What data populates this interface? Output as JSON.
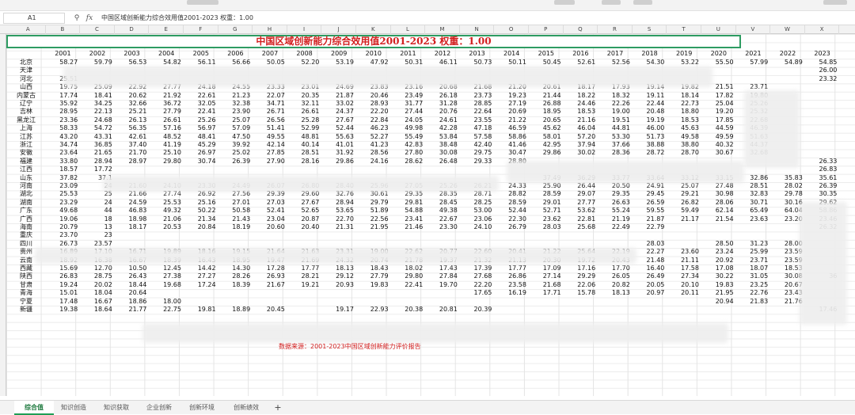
{
  "formula_bar": {
    "cell_ref": "A1",
    "formula": "中国区域创新能力综合效用值2001-2023   权重：1.00",
    "zoom_icon": "zoom-icon",
    "fx_label": "fx"
  },
  "columns": [
    "A",
    "B",
    "C",
    "D",
    "E",
    "F",
    "G",
    "H",
    "I",
    "J",
    "K",
    "L",
    "M",
    "N",
    "O",
    "P",
    "Q",
    "R",
    "S",
    "T",
    "U",
    "V",
    "W",
    "X"
  ],
  "title": "中国区域创新能力综合效用值2001-2023    权重：1.00",
  "years": [
    "2001",
    "2002",
    "2003",
    "2004",
    "2005",
    "2006",
    "2007",
    "2008",
    "2009",
    "2010",
    "2011",
    "2012",
    "2013",
    "2014",
    "2015",
    "2016",
    "2017",
    "2018",
    "2019",
    "2020",
    "2021",
    "2022",
    "2023"
  ],
  "regions": [
    "北京",
    "天津",
    "河北",
    "山西",
    "内蒙古",
    "辽宁",
    "吉林",
    "黑龙江",
    "上海",
    "江苏",
    "浙江",
    "安徽",
    "福建",
    "江西",
    "山东",
    "河南",
    "湖北",
    "湖南",
    "广东",
    "广西",
    "海南",
    "重庆",
    "四川",
    "贵州",
    "云南",
    "西藏",
    "陕西",
    "甘肃",
    "青海",
    "宁夏",
    "新疆"
  ],
  "rows": [
    [
      "58.27",
      "59.79",
      "56.53",
      "54.82",
      "56.11",
      "56.66",
      "50.05",
      "52.20",
      "53.19",
      "47.92",
      "50.31",
      "46.11",
      "50.73",
      "50.11",
      "50.45",
      "52.61",
      "52.56",
      "54.30",
      "53.22",
      "55.50",
      "57.99",
      "54.89",
      "54.85"
    ],
    [
      "",
      "",
      "",
      "",
      "",
      "",
      "",
      "",
      "",
      "",
      "",
      "",
      "",
      "",
      "",
      "",
      "",
      "",
      "",
      "",
      "",
      "",
      "26.00"
    ],
    [
      "25.51",
      "",
      "",
      "",
      "",
      "",
      "",
      "",
      "",
      "",
      "",
      "",
      "",
      "",
      "",
      "",
      "",
      "",
      "",
      "",
      "",
      "",
      "23.32"
    ],
    [
      "19.75",
      "25.09",
      "22.92",
      "27.77",
      "24.18",
      "24.55",
      "23.33",
      "23.01",
      "24.69",
      "23.83",
      "23.16",
      "20.68",
      "21.68",
      "21.20",
      "20.61",
      "18.17",
      "17.93",
      "19.14",
      "19.82",
      "21.51",
      "23.71",
      "",
      ""
    ],
    [
      "17.74",
      "18.41",
      "20.62",
      "21.92",
      "22.61",
      "21.23",
      "22.07",
      "20.35",
      "21.87",
      "20.46",
      "23.49",
      "26.18",
      "23.73",
      "19.23",
      "21.44",
      "18.22",
      "18.32",
      "19.11",
      "18.14",
      "17.82",
      "19.80",
      "",
      ""
    ],
    [
      "35.92",
      "34.25",
      "32.66",
      "36.72",
      "32.05",
      "32.38",
      "34.71",
      "32.11",
      "33.02",
      "28.93",
      "31.77",
      "31.28",
      "28.85",
      "27.19",
      "26.88",
      "24.46",
      "22.26",
      "22.44",
      "22.73",
      "25.04",
      "25.26",
      "",
      ""
    ],
    [
      "28.95",
      "22.13",
      "25.21",
      "27.79",
      "22.41",
      "23.90",
      "26.71",
      "26.61",
      "24.37",
      "22.20",
      "27.44",
      "20.76",
      "22.64",
      "20.69",
      "18.95",
      "18.53",
      "19.00",
      "20.48",
      "18.80",
      "19.20",
      "25.32",
      "",
      ""
    ],
    [
      "23.36",
      "24.68",
      "26.13",
      "26.61",
      "25.26",
      "25.07",
      "26.56",
      "25.28",
      "27.67",
      "22.84",
      "24.05",
      "24.61",
      "23.55",
      "21.22",
      "20.65",
      "21.16",
      "19.51",
      "19.19",
      "18.53",
      "17.85",
      "22.68",
      "",
      ""
    ],
    [
      "58.33",
      "54.72",
      "56.35",
      "57.16",
      "56.97",
      "57.09",
      "51.41",
      "52.99",
      "52.44",
      "46.23",
      "49.98",
      "42.28",
      "47.18",
      "46.59",
      "45.62",
      "46.04",
      "44.81",
      "46.00",
      "45.63",
      "44.59",
      "46.39",
      "",
      ""
    ],
    [
      "43.20",
      "43.31",
      "42.61",
      "48.52",
      "48.41",
      "47.50",
      "49.55",
      "48.81",
      "55.63",
      "52.27",
      "55.49",
      "53.84",
      "57.58",
      "58.86",
      "58.01",
      "57.20",
      "53.30",
      "51.73",
      "49.58",
      "49.59",
      "51.63",
      "",
      ""
    ],
    [
      "34.74",
      "36.85",
      "37.40",
      "41.19",
      "45.29",
      "39.92",
      "42.14",
      "40.14",
      "41.01",
      "41.23",
      "42.83",
      "38.48",
      "42.40",
      "41.46",
      "42.95",
      "37.94",
      "37.66",
      "38.88",
      "38.80",
      "40.32",
      "44.37",
      "",
      ""
    ],
    [
      "23.64",
      "21.65",
      "21.70",
      "25.10",
      "26.97",
      "25.02",
      "27.85",
      "28.51",
      "31.92",
      "28.56",
      "27.80",
      "30.08",
      "29.75",
      "30.47",
      "29.86",
      "30.02",
      "28.36",
      "28.72",
      "28.70",
      "30.67",
      "32.68",
      "",
      ""
    ],
    [
      "33.80",
      "28.94",
      "28.97",
      "29.80",
      "30.74",
      "26.39",
      "27.90",
      "28.16",
      "29.86",
      "24.16",
      "28.62",
      "26.48",
      "29.33",
      "28.80",
      "",
      "",
      "",
      "",
      "",
      "",
      "",
      "",
      "26.33"
    ],
    [
      "18.57",
      "17.72",
      "",
      "",
      "",
      "",
      "",
      "",
      "",
      "",
      "",
      "",
      "",
      "",
      "",
      "",
      "",
      "",
      "",
      "",
      "",
      "",
      "26.83"
    ],
    [
      "37.82",
      "37.1",
      "",
      "",
      "",
      "",
      "",
      "",
      "",
      "",
      "",
      "",
      "",
      "",
      "37.49",
      "36.29",
      "33.77",
      "33.64",
      "33.12",
      "33.15",
      "32.86",
      "35.83",
      "35.61"
    ],
    [
      "23.09",
      "24",
      "21.60",
      "24.10",
      "23.30",
      "24.49",
      "26.07",
      "26.80",
      "28.40",
      "25.96",
      "27.05",
      "25.26",
      "26.21",
      "24.33",
      "25.90",
      "26.44",
      "20.50",
      "24.91",
      "25.07",
      "27.48",
      "28.51",
      "28.02",
      "26.39"
    ],
    [
      "25.53",
      "25",
      "21.66",
      "27.74",
      "26.92",
      "27.56",
      "29.39",
      "29.60",
      "32.76",
      "30.61",
      "29.35",
      "28.35",
      "28.71",
      "28.82",
      "28.59",
      "29.07",
      "29.35",
      "29.45",
      "29.21",
      "30.98",
      "32.83",
      "29.78",
      "30.35"
    ],
    [
      "23.29",
      "24",
      "24.59",
      "25.53",
      "25.16",
      "27.01",
      "27.03",
      "27.67",
      "28.94",
      "29.79",
      "29.81",
      "28.45",
      "28.25",
      "28.59",
      "29.01",
      "27.77",
      "26.63",
      "26.59",
      "26.82",
      "28.06",
      "30.71",
      "30.16",
      "29.62"
    ],
    [
      "49.68",
      "44",
      "46.83",
      "49.32",
      "50.22",
      "50.58",
      "52.41",
      "52.65",
      "53.65",
      "51.89",
      "54.88",
      "49.38",
      "53.00",
      "52.44",
      "52.71",
      "53.62",
      "55.24",
      "59.55",
      "59.49",
      "62.14",
      "65.49",
      "64.04",
      "58.86"
    ],
    [
      "19.06",
      "18",
      "18.98",
      "21.06",
      "21.34",
      "21.43",
      "23.04",
      "20.87",
      "22.70",
      "22.56",
      "23.41",
      "22.67",
      "23.06",
      "22.30",
      "23.62",
      "22.81",
      "21.19",
      "21.87",
      "21.17",
      "21.54",
      "23.63",
      "23.20",
      "23.46"
    ],
    [
      "20.79",
      "13",
      "18.17",
      "20.53",
      "20.84",
      "18.19",
      "20.60",
      "20.40",
      "21.31",
      "21.95",
      "21.46",
      "23.30",
      "24.10",
      "26.79",
      "28.03",
      "25.68",
      "22.49",
      "22.79",
      "",
      "",
      "",
      "",
      "26.32"
    ],
    [
      "23.70",
      "23",
      "",
      "",
      "",
      "",
      "",
      "",
      "",
      "",
      "",
      "",
      "",
      "",
      "",
      "",
      "",
      "",
      "",
      "",
      "",
      "",
      ""
    ],
    [
      "26.73",
      "23.57",
      "",
      "",
      "",
      "",
      "",
      "",
      "",
      "",
      "",
      "",
      "",
      "",
      "",
      "",
      "",
      "28.03",
      "",
      "28.50",
      "31.23",
      "28.00",
      ""
    ],
    [
      "16.89",
      "17.10",
      "16.71",
      "19.89",
      "18.16",
      "19.15",
      "21.64",
      "21.63",
      "23.31",
      "19.00",
      "22.62",
      "20.77",
      "22.60",
      "20.41",
      "21.22",
      "25.64",
      "22.19",
      "22.27",
      "23.60",
      "23.24",
      "25.99",
      "23.59",
      ""
    ],
    [
      "18.92",
      "16.38",
      "16.67",
      "18.39",
      "16.43",
      "18.95",
      "19.47",
      "21.69",
      "24.32",
      "20.74",
      "21.78",
      "19.37",
      "21.32",
      "21.13",
      "20.30",
      "19.72",
      "20.43",
      "21.48",
      "21.11",
      "20.92",
      "23.71",
      "23.59",
      ""
    ],
    [
      "15.69",
      "12.70",
      "10.50",
      "12.45",
      "14.42",
      "14.30",
      "17.28",
      "17.77",
      "18.13",
      "18.43",
      "18.02",
      "17.43",
      "17.39",
      "17.77",
      "17.09",
      "17.16",
      "17.70",
      "16.40",
      "17.58",
      "17.08",
      "18.07",
      "18.53",
      ""
    ],
    [
      "26.83",
      "28.75",
      "26.43",
      "27.38",
      "27.27",
      "28.26",
      "26.93",
      "28.21",
      "29.12",
      "27.79",
      "29.80",
      "27.84",
      "27.68",
      "26.86",
      "27.14",
      "29.29",
      "26.05",
      "26.49",
      "27.34",
      "30.22",
      "31.05",
      "30.08",
      "36"
    ],
    [
      "19.24",
      "20.02",
      "18.44",
      "19.68",
      "17.24",
      "18.39",
      "21.67",
      "19.21",
      "20.93",
      "19.83",
      "22.41",
      "19.70",
      "22.20",
      "23.58",
      "21.68",
      "22.06",
      "20.82",
      "20.05",
      "20.10",
      "19.83",
      "23.25",
      "20.67",
      ""
    ],
    [
      "15.01",
      "18.04",
      "20.64",
      "",
      "",
      "",
      "",
      "",
      "",
      "",
      "",
      "",
      "17.65",
      "16.19",
      "17.71",
      "15.78",
      "18.13",
      "20.97",
      "20.11",
      "21.95",
      "22.76",
      "23.43",
      ""
    ],
    [
      "17.48",
      "16.67",
      "18.86",
      "18.00",
      "",
      "",
      "",
      "",
      "",
      "",
      "",
      "",
      "",
      "",
      "",
      "",
      "",
      "",
      "",
      "20.94",
      "21.83",
      "21.76",
      ""
    ],
    [
      "19.38",
      "18.64",
      "21.77",
      "22.75",
      "19.81",
      "18.89",
      "20.45",
      "",
      "19.17",
      "22.93",
      "20.38",
      "20.81",
      "20.39",
      "",
      "",
      "",
      "",
      "",
      "",
      "",
      "",
      "",
      "17.46"
    ]
  ],
  "source_note": "数据来源：2001-2023中国区域创新能力评价报告",
  "tabs": [
    {
      "label": "综合值",
      "active": true
    },
    {
      "label": "知识创造",
      "active": false
    },
    {
      "label": "知识获取",
      "active": false
    },
    {
      "label": "企业创新",
      "active": false
    },
    {
      "label": "创新环境",
      "active": false
    },
    {
      "label": "创新绩效",
      "active": false
    }
  ],
  "add_tab_label": "+",
  "colors": {
    "title_red": "#d21f1f",
    "active_tab_green": "#1f9e55",
    "selection_green": "#2e9c62"
  }
}
